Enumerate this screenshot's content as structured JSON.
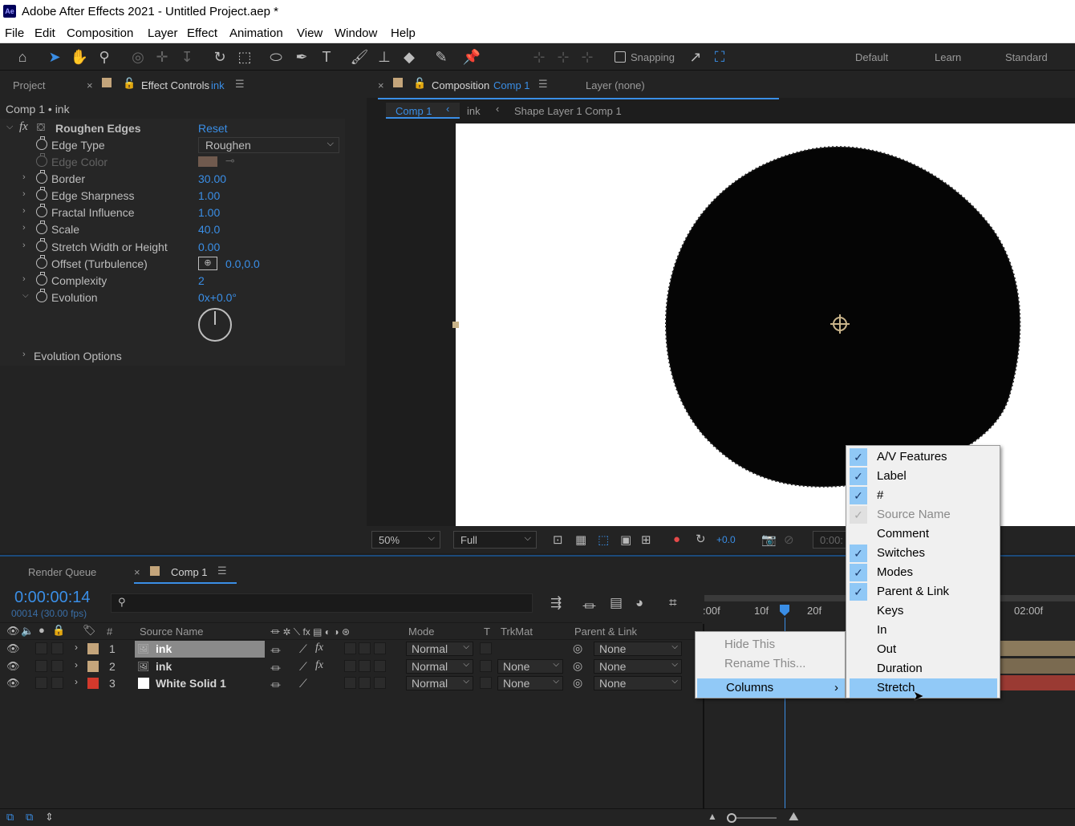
{
  "window": {
    "title": "Adobe After Effects 2021 - Untitled Project.aep *",
    "app_icon": "Ae"
  },
  "menu": [
    "File",
    "Edit",
    "Composition",
    "Layer",
    "Effect",
    "Animation",
    "View",
    "Window",
    "Help"
  ],
  "toolbar": {
    "snapping": "Snapping",
    "workspaces": [
      "Default",
      "Learn",
      "Standard"
    ]
  },
  "left_panel": {
    "tabs": {
      "project": "Project",
      "effect_controls": "Effect Controls",
      "effect_controls_layer": "ink"
    },
    "breadcrumb": "Comp 1 • ink",
    "effect": {
      "name": "Roughen Edges",
      "reset": "Reset"
    },
    "props": [
      {
        "label": "Edge Type",
        "value": "Roughen"
      },
      {
        "label": "Edge Color",
        "value": ""
      },
      {
        "label": "Border",
        "value": "30.00"
      },
      {
        "label": "Edge Sharpness",
        "value": "1.00"
      },
      {
        "label": "Fractal Influence",
        "value": "1.00"
      },
      {
        "label": "Scale",
        "value": "40.0"
      },
      {
        "label": "Stretch Width or Height",
        "value": "0.00"
      },
      {
        "label": "Offset (Turbulence)",
        "value": "0.0,0.0"
      },
      {
        "label": "Complexity",
        "value": "2"
      },
      {
        "label": "Evolution",
        "value": "0x+0.0°"
      }
    ],
    "evolution_options": "Evolution Options",
    "edge_color": "#e0a98a"
  },
  "viewer": {
    "tab_label": "Composition",
    "tab_comp": "Comp 1",
    "layer_tab": "Layer (none)",
    "crumbs": [
      "Comp 1",
      "ink",
      "Shape Layer 1 Comp 1"
    ],
    "zoom": "50%",
    "resolution": "Full",
    "exposure": "+0.0",
    "timecode_partial": "0:00:"
  },
  "timeline": {
    "tabs": {
      "render_queue": "Render Queue",
      "comp": "Comp 1"
    },
    "timecode": "0:00:00:14",
    "frame_info": "00014 (30.00 fps)",
    "search_placeholder": "",
    "headers": {
      "num": "#",
      "source": "Source Name",
      "mode": "Mode",
      "t": "T",
      "trkmat": "TrkMat",
      "parent": "Parent & Link"
    },
    "ruler": [
      ":00f",
      "10f",
      "20f",
      "02:00f"
    ],
    "layers": [
      {
        "num": "1",
        "name": "ink",
        "mode": "Normal",
        "trkmat": "",
        "parent": "None",
        "color": "#c4a57b"
      },
      {
        "num": "2",
        "name": "ink",
        "mode": "Normal",
        "trkmat": "None",
        "parent": "None",
        "color": "#c4a57b"
      },
      {
        "num": "3",
        "name": "White Solid 1",
        "mode": "Normal",
        "trkmat": "None",
        "parent": "None",
        "color": "#d2392c"
      }
    ]
  },
  "context_menu": {
    "items": [
      "Hide This",
      "Rename This...",
      "Columns"
    ],
    "submenu": [
      {
        "label": "A/V Features",
        "checked": true
      },
      {
        "label": "Label",
        "checked": true
      },
      {
        "label": "#",
        "checked": true
      },
      {
        "label": "Source Name",
        "checked": "disabled"
      },
      {
        "label": "Comment",
        "checked": false
      },
      {
        "label": "Switches",
        "checked": true
      },
      {
        "label": "Modes",
        "checked": true
      },
      {
        "label": "Parent & Link",
        "checked": true
      },
      {
        "label": "Keys",
        "checked": false
      },
      {
        "label": "In",
        "checked": false
      },
      {
        "label": "Out",
        "checked": false
      },
      {
        "label": "Duration",
        "checked": false
      },
      {
        "label": "Stretch",
        "checked": false
      }
    ]
  }
}
